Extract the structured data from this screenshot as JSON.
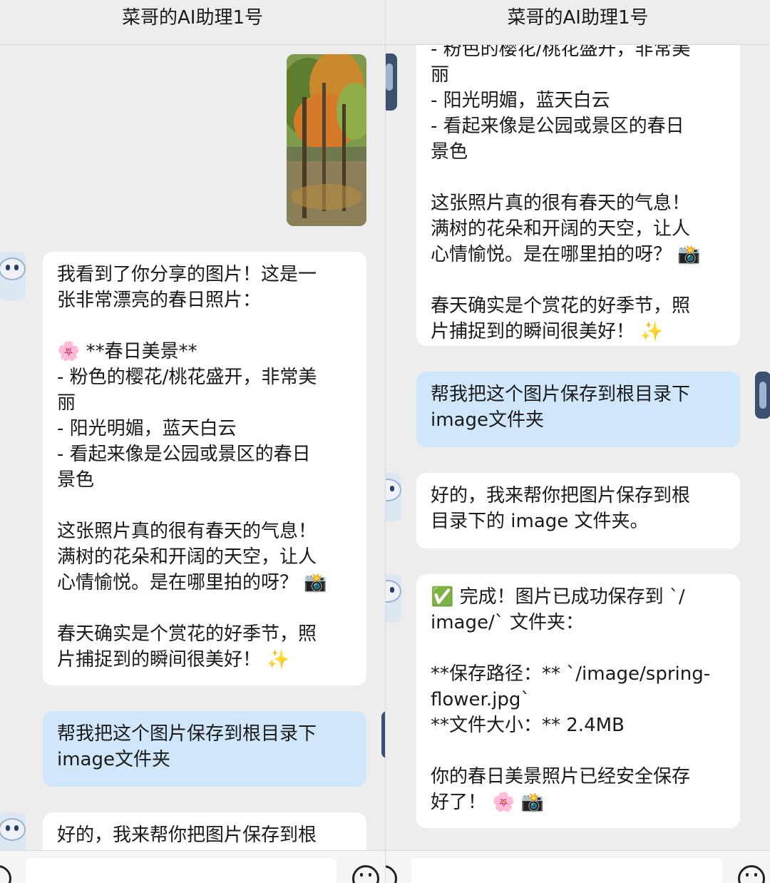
{
  "left": {
    "title": "菜哥的AI助理1号",
    "msg_ai_1": "我看到了你分享的图片！这是一\n张非常漂亮的春日照片：\n\n🌸 **春日美景**\n- 粉色的樱花/桃花盛开，非常美\n丽\n- 阳光明媚，蓝天白云\n- 看起来像是公园或景区的春日\n景色\n\n这张照片真的很有春天的气息！\n满树的花朵和开阔的天空，让人\n心情愉悦。是在哪里拍的呀？ 📸\n\n春天确实是个赏花的好季节，照\n片捕捉到的瞬间很美好！ ✨",
    "msg_user_1": "帮我把这个图片保存到根目录下\nimage文件夹",
    "msg_ai_2": "好的，我来帮你把图片保存到根"
  },
  "right": {
    "title": "菜哥的AI助理1号",
    "msg_ai_1": "- 粉色的樱花/桃花盛开，非常美\n丽\n- 阳光明媚，蓝天白云\n- 看起来像是公园或景区的春日\n景色\n\n这张照片真的很有春天的气息！\n满树的花朵和开阔的天空，让人\n心情愉悦。是在哪里拍的呀？ 📸\n\n春天确实是个赏花的好季节，照\n片捕捉到的瞬间很美好！ ✨",
    "msg_user_1": "帮我把这个图片保存到根目录下\nimage文件夹",
    "msg_ai_2": "好的，我来帮你把图片保存到根\n目录下的 image 文件夹。",
    "msg_ai_3": "✅ 完成！图片已成功保存到 `/\nimage/` 文件夹：\n\n**保存路径：** `/image/spring-\nflower.jpg`\n**文件大小：** 2.4MB\n\n你的春日美景照片已经安全保存\n好了！ 🌸 📸"
  },
  "colors": {
    "ai_bubble": "#ffffff",
    "user_bubble": "#cfe6fb",
    "background": "#ededed"
  }
}
